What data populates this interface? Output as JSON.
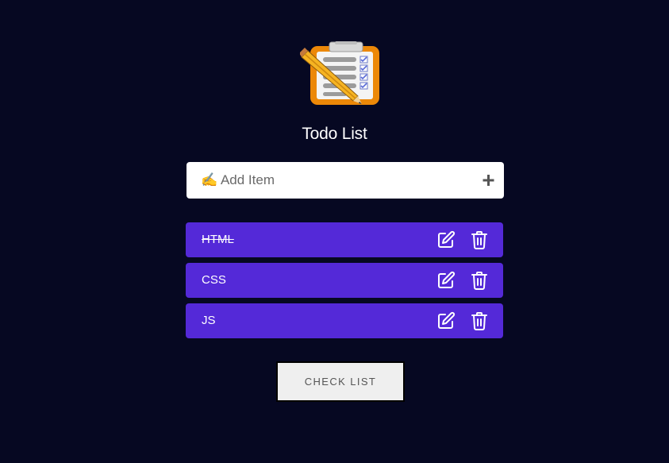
{
  "app": {
    "title": "Todo List",
    "logo_icon": "clipboard-checklist-pencil-icon"
  },
  "add_item": {
    "placeholder": "✍️ Add Item",
    "value": "",
    "add_icon": "plus-icon"
  },
  "todos": [
    {
      "text": "HTML",
      "completed": true
    },
    {
      "text": "CSS",
      "completed": false
    },
    {
      "text": "JS",
      "completed": false
    }
  ],
  "item_actions": {
    "edit_icon": "edit-icon",
    "delete_icon": "trash-icon"
  },
  "check_list_button": {
    "label": "CHECK LIST"
  },
  "colors": {
    "background": "#060822",
    "item_background": "#5429d8",
    "text": "#ffffff"
  }
}
